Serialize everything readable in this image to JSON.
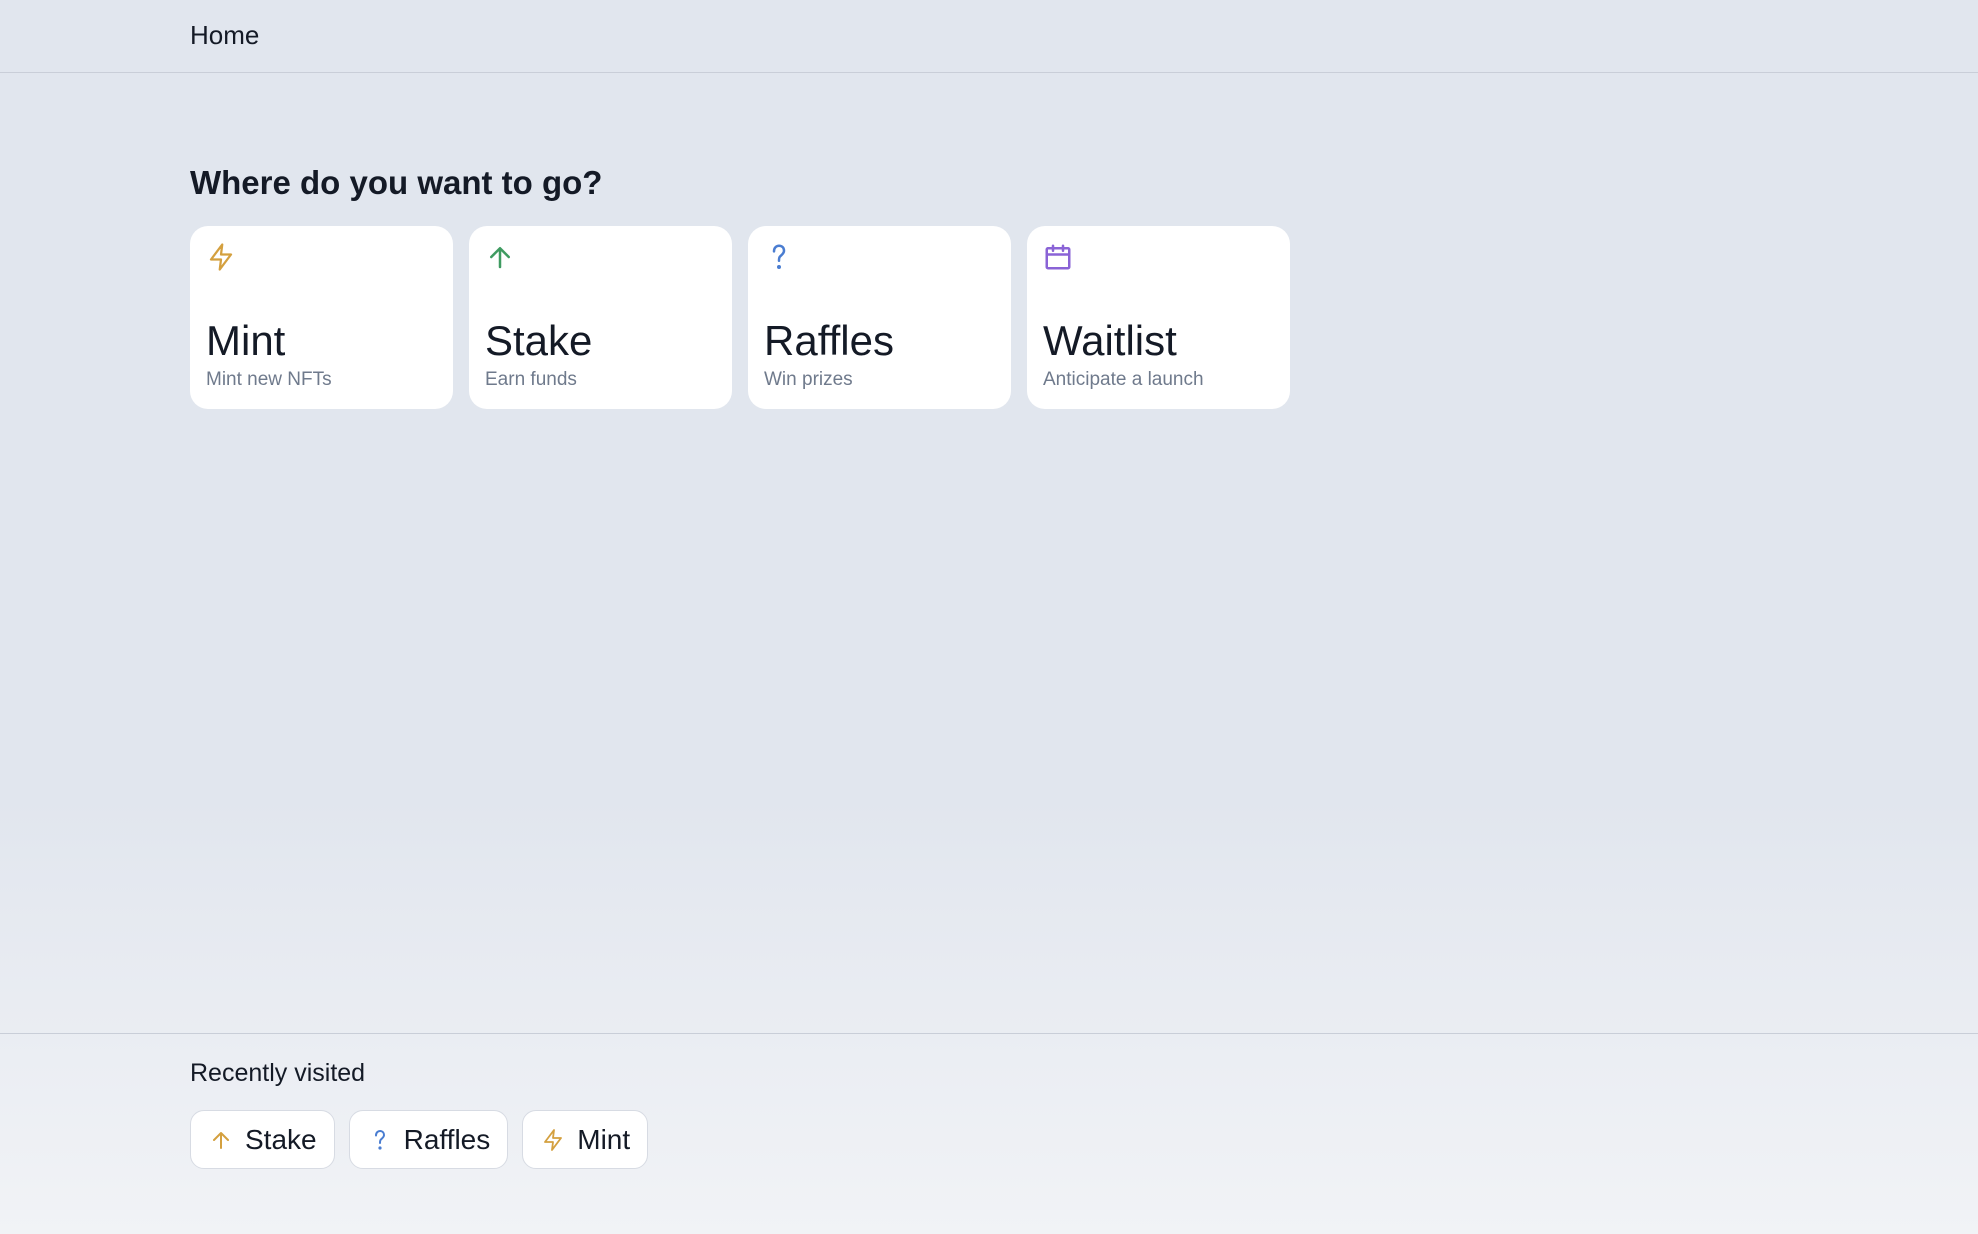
{
  "header": {
    "title": "Home"
  },
  "main": {
    "heading": "Where do you want to go?",
    "cards": [
      {
        "icon": "lightning-bolt-icon",
        "icon_color": "#d4a03f",
        "title": "Mint",
        "subtitle": "Mint new NFTs"
      },
      {
        "icon": "arrow-up-icon",
        "icon_color": "#3f9b61",
        "title": "Stake",
        "subtitle": "Earn funds"
      },
      {
        "icon": "question-mark-icon",
        "icon_color": "#4a7dd1",
        "title": "Raffles",
        "subtitle": "Win prizes"
      },
      {
        "icon": "calendar-icon",
        "icon_color": "#8a63d6",
        "title": "Waitlist",
        "subtitle": "Anticipate a launch"
      }
    ]
  },
  "recent": {
    "heading": "Recently visited",
    "items": [
      {
        "icon": "arrow-up-icon",
        "icon_color": "#d4a03f",
        "label": "Stake"
      },
      {
        "icon": "question-mark-icon",
        "icon_color": "#4a7dd1",
        "label": "Raffles"
      },
      {
        "icon": "lightning-bolt-icon",
        "icon_color": "#d4a03f",
        "label": "Mint"
      }
    ]
  },
  "colors": {
    "background": "#e1e6ee",
    "card_background": "#ffffff",
    "text_primary": "#141a26",
    "text_secondary": "#6f7a8c"
  }
}
